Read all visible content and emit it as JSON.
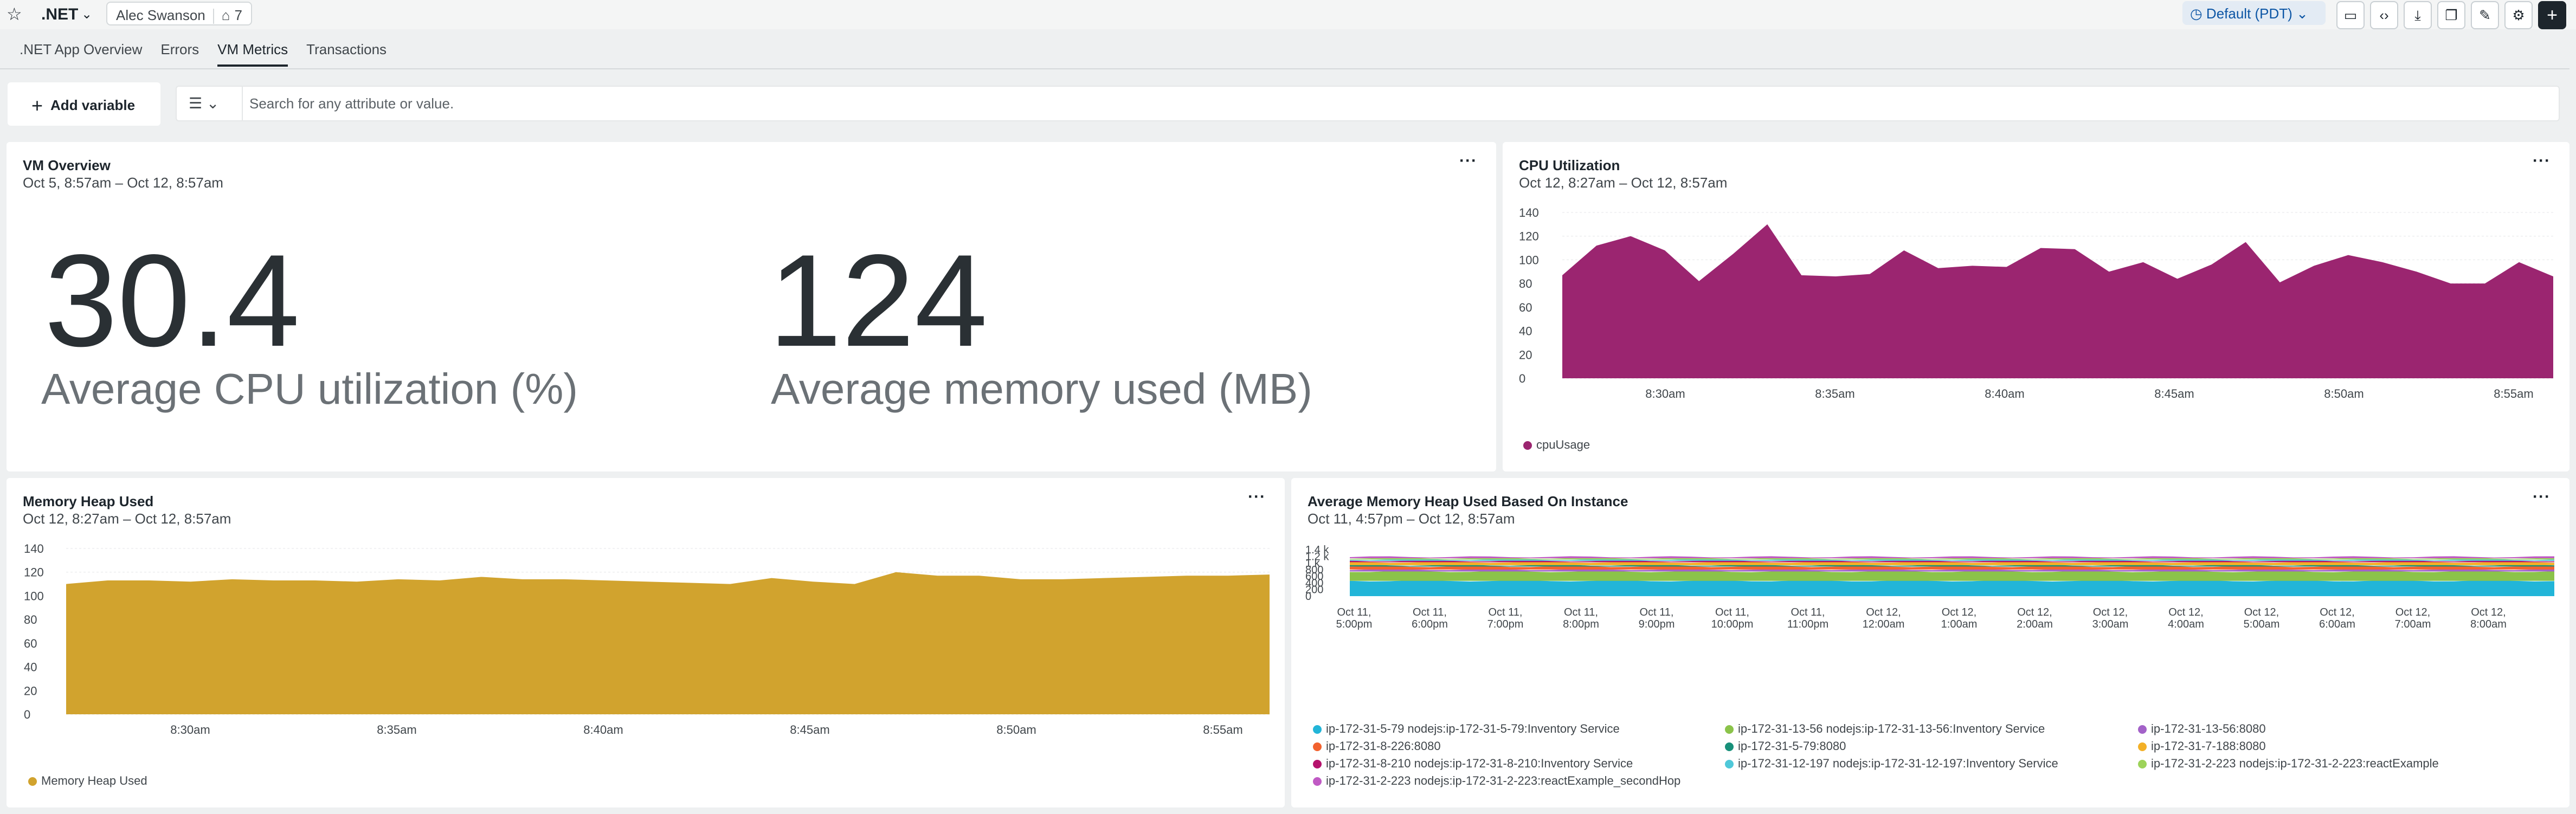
{
  "header": {
    "app_title": ".NET",
    "owner": "Alec Swanson",
    "tag_count": "7",
    "timepicker": "Default (PDT)"
  },
  "tabs": [
    {
      "label": ".NET App Overview"
    },
    {
      "label": "Errors"
    },
    {
      "label": "VM Metrics"
    },
    {
      "label": "Transactions"
    }
  ],
  "toolbar": {
    "add_variable": "Add variable",
    "search_placeholder": "Search for any attribute or value."
  },
  "vm_overview": {
    "title": "VM Overview",
    "range": "Oct 5, 8:57am – Oct 12, 8:57am",
    "cpu_value": "30.4",
    "cpu_label": "Average CPU utilization (%)",
    "mem_value": "124",
    "mem_label": "Average memory used (MB)"
  },
  "cpu_panel": {
    "title": "CPU Utilization",
    "range": "Oct 12, 8:27am – Oct 12, 8:57am",
    "legend": "cpuUsage",
    "color": "#9b2570"
  },
  "heap_panel": {
    "title": "Memory Heap Used",
    "range": "Oct 12, 8:27am – Oct 12, 8:57am",
    "legend": "Memory Heap Used",
    "color": "#d1a32e"
  },
  "avg_heap_panel": {
    "title": "Average Memory Heap Used Based On Instance",
    "range": "Oct 11, 4:57pm – Oct 12, 8:57am",
    "legend": [
      {
        "label": "ip-172-31-5-79 nodejs:ip-172-31-5-79:Inventory Service",
        "color": "#22b5d8"
      },
      {
        "label": "ip-172-31-13-56 nodejs:ip-172-31-13-56:Inventory Service",
        "color": "#8bc34a"
      },
      {
        "label": "ip-172-31-13-56:8080",
        "color": "#a362c8"
      },
      {
        "label": "ip-172-31-8-226:8080",
        "color": "#f2622e"
      },
      {
        "label": "ip-172-31-5-79:8080",
        "color": "#18907a"
      },
      {
        "label": "ip-172-31-7-188:8080",
        "color": "#f3b027"
      },
      {
        "label": "ip-172-31-8-210 nodejs:ip-172-31-8-210:Inventory Service",
        "color": "#b5126c"
      },
      {
        "label": "ip-172-31-12-197 nodejs:ip-172-31-12-197:Inventory Service",
        "color": "#4fc8d9"
      },
      {
        "label": "ip-172-31-2-223 nodejs:ip-172-31-2-223:reactExample",
        "color": "#9dd35a"
      },
      {
        "label": "ip-172-31-2-223 nodejs:ip-172-31-2-223:reactExample_secondHop",
        "color": "#c05ac4"
      }
    ]
  },
  "chart_data": [
    {
      "type": "area",
      "title": "CPU Utilization",
      "series": [
        {
          "name": "cpuUsage",
          "values": [
            87,
            112,
            120,
            108,
            82,
            105,
            130,
            87,
            86,
            88,
            108,
            93,
            95,
            94,
            110,
            109,
            90,
            98,
            84,
            96,
            115,
            81,
            95,
            104,
            98,
            90,
            80,
            80,
            98,
            86
          ]
        }
      ],
      "x_ticks": [
        "8:30am",
        "8:35am",
        "8:40am",
        "8:45am",
        "8:50am",
        "8:55am"
      ],
      "y_ticks": [
        "0",
        "20",
        "40",
        "60",
        "80",
        "100",
        "120",
        "140"
      ],
      "ylim": [
        0,
        140
      ]
    },
    {
      "type": "area",
      "title": "Memory Heap Used",
      "series": [
        {
          "name": "Memory Heap Used",
          "values": [
            110,
            113,
            113,
            112,
            114,
            113,
            113,
            112,
            114,
            113,
            116,
            114,
            114,
            113,
            112,
            111,
            110,
            115,
            112,
            110,
            120,
            117,
            117,
            114,
            114,
            115,
            116,
            117,
            117,
            118
          ]
        }
      ],
      "x_ticks": [
        "8:30am",
        "8:35am",
        "8:40am",
        "8:45am",
        "8:50am",
        "8:55am"
      ],
      "y_ticks": [
        "0",
        "20",
        "40",
        "60",
        "80",
        "100",
        "120",
        "140"
      ],
      "ylim": [
        0,
        140
      ]
    },
    {
      "type": "area",
      "title": "Average Memory Heap Used Based On Instance",
      "stacked": true,
      "y_ticks": [
        "0",
        "200",
        "400",
        "600",
        "800",
        "1 k",
        "1.2 k",
        "1.4 k"
      ],
      "x_ticks": [
        "Oct 11,\n5:00pm",
        "Oct 11,\n6:00pm",
        "Oct 11,\n7:00pm",
        "Oct 11,\n8:00pm",
        "Oct 11,\n9:00pm",
        "Oct 11,\n10:00pm",
        "Oct 11,\n11:00pm",
        "Oct 12,\n12:00am",
        "Oct 12,\n1:00am",
        "Oct 12,\n2:00am",
        "Oct 12,\n3:00am",
        "Oct 12,\n4:00am",
        "Oct 12,\n5:00am",
        "Oct 12,\n6:00am",
        "Oct 12,\n7:00am",
        "Oct 12,\n8:00am"
      ],
      "ylim": [
        0,
        1400
      ],
      "series": [
        {
          "name": "ip-172-31-5-79 nodejs:ip-172-31-5-79:Inventory Service",
          "value": 460
        },
        {
          "name": "ip-172-31-13-56 nodejs:ip-172-31-13-56:Inventory Service",
          "value": 280
        },
        {
          "name": "ip-172-31-13-56:8080",
          "value": 60
        },
        {
          "name": "ip-172-31-8-226:8080",
          "value": 90
        },
        {
          "name": "ip-172-31-5-79:8080",
          "value": 40
        },
        {
          "name": "ip-172-31-7-188:8080",
          "value": 90
        },
        {
          "name": "ip-172-31-8-210 nodejs:ip-172-31-8-210:Inventory Service",
          "value": 40
        },
        {
          "name": "ip-172-31-12-197 nodejs:ip-172-31-12-197:Inventory Service",
          "value": 40
        },
        {
          "name": "ip-172-31-2-223 nodejs:ip-172-31-2-223:reactExample",
          "value": 40
        },
        {
          "name": "ip-172-31-2-223 nodejs:ip-172-31-2-223:reactExample_secondHop",
          "value": 40
        }
      ]
    }
  ]
}
